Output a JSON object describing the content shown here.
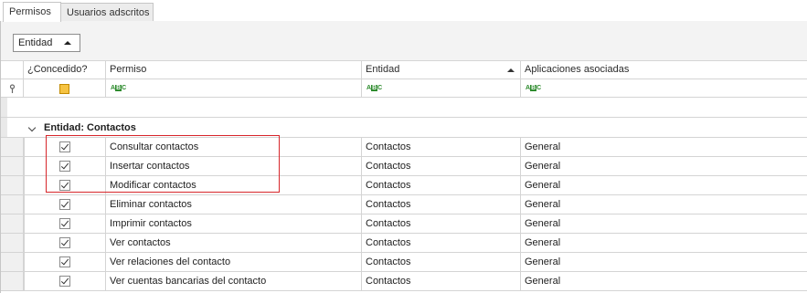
{
  "tabs": [
    {
      "label": "Permisos",
      "active": true
    },
    {
      "label": "Usuarios adscritos",
      "active": false
    }
  ],
  "group_panel": {
    "chip_label": "Entidad",
    "sort": "ascending"
  },
  "grid": {
    "columns": [
      {
        "label": "¿Concedido?"
      },
      {
        "label": "Permiso"
      },
      {
        "label": "Entidad",
        "sorted": "ascending"
      },
      {
        "label": "Aplicaciones  asociadas"
      }
    ],
    "filter_row": {
      "c1": "",
      "c2_icon": "text-filter-icon",
      "c3_icon": "text-filter-icon",
      "c4_icon": "text-filter-icon",
      "abc_a": "A",
      "abc_b": "B",
      "abc_c": "C"
    },
    "group": {
      "label": "Entidad: Contactos"
    },
    "rows": [
      {
        "checked": true,
        "permiso": "Consultar contactos",
        "entidad": "Contactos",
        "aplicaciones": "General"
      },
      {
        "checked": true,
        "permiso": "Insertar contactos",
        "entidad": "Contactos",
        "aplicaciones": "General"
      },
      {
        "checked": true,
        "permiso": "Modificar contactos",
        "entidad": "Contactos",
        "aplicaciones": "General"
      },
      {
        "checked": true,
        "permiso": "Eliminar contactos",
        "entidad": "Contactos",
        "aplicaciones": "General"
      },
      {
        "checked": true,
        "permiso": "Imprimir contactos",
        "entidad": "Contactos",
        "aplicaciones": "General"
      },
      {
        "checked": true,
        "permiso": "Ver contactos",
        "entidad": "Contactos",
        "aplicaciones": "General"
      },
      {
        "checked": true,
        "permiso": "Ver relaciones del contacto",
        "entidad": "Contactos",
        "aplicaciones": "General"
      },
      {
        "checked": true,
        "permiso": "Ver cuentas bancarias del contacto",
        "entidad": "Contactos",
        "aplicaciones": "General"
      }
    ]
  },
  "colors": {
    "highlight": "#d7262b",
    "filter_check": "#f6c342",
    "abc_icon": "#2e8b2e"
  }
}
